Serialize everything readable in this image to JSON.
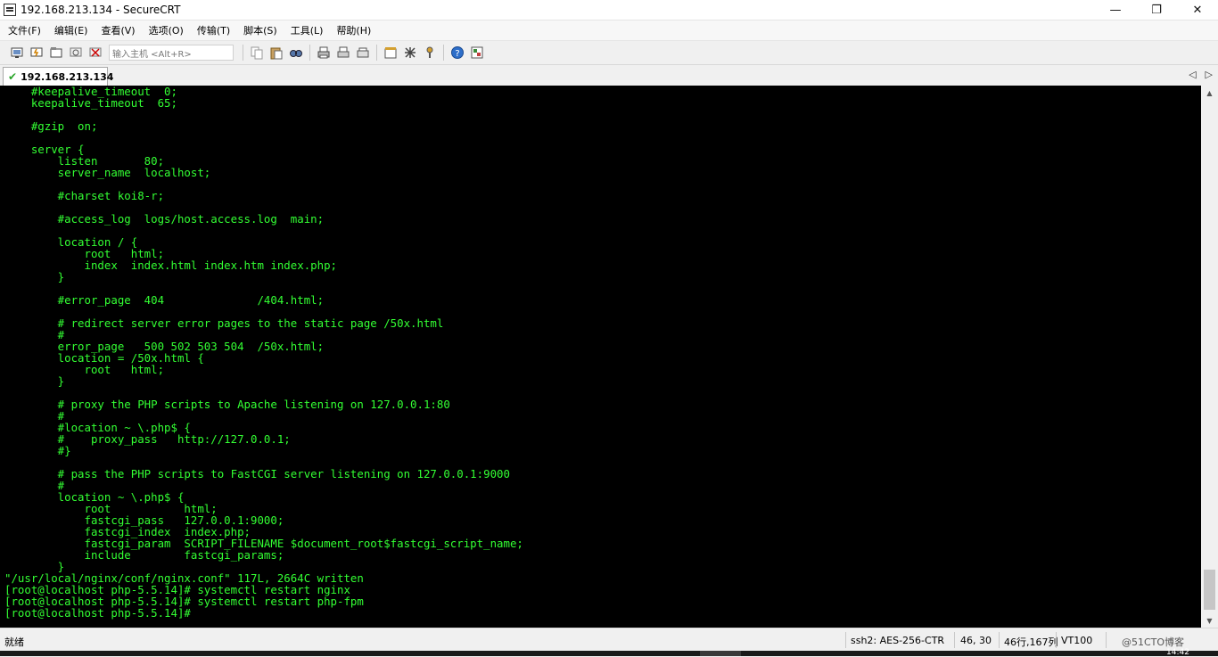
{
  "window": {
    "title": "192.168.213.134 - SecureCRT",
    "minimize": "—",
    "maximize": "❐",
    "close": "✕"
  },
  "menu": [
    "文件(F)",
    "编辑(E)",
    "查看(V)",
    "选项(O)",
    "传输(T)",
    "脚本(S)",
    "工具(L)",
    "帮助(H)"
  ],
  "toolbar": {
    "quick_connect_placeholder": "输入主机 <Alt+R>",
    "icons_left": [
      "connect-icon",
      "quick-connect-icon",
      "connect-tab-icon",
      "reconnect-icon",
      "disconnect-icon"
    ],
    "icons_right": [
      "copy-icon",
      "paste-icon",
      "find-icon",
      "print-icon",
      "print-selection-icon",
      "print-setup-icon",
      "session-options-icon",
      "global-options-icon",
      "keymap-icon",
      "help-icon",
      "sftp-icon"
    ]
  },
  "tab": {
    "label": "192.168.213.134",
    "status_icon": "connected-check-icon",
    "nav_left": "◁",
    "nav_right": "▷"
  },
  "terminal": {
    "text_color": "#33ff33",
    "background": "#000000",
    "lines": [
      "    #keepalive_timeout  0;",
      "    keepalive_timeout  65;",
      "",
      "    #gzip  on;",
      "",
      "    server {",
      "        listen       80;",
      "        server_name  localhost;",
      "",
      "        #charset koi8-r;",
      "",
      "        #access_log  logs/host.access.log  main;",
      "",
      "        location / {",
      "            root   html;",
      "            index  index.html index.htm index.php;",
      "        }",
      "",
      "        #error_page  404              /404.html;",
      "",
      "        # redirect server error pages to the static page /50x.html",
      "        #",
      "        error_page   500 502 503 504  /50x.html;",
      "        location = /50x.html {",
      "            root   html;",
      "        }",
      "",
      "        # proxy the PHP scripts to Apache listening on 127.0.0.1:80",
      "        #",
      "        #location ~ \\.php$ {",
      "        #    proxy_pass   http://127.0.0.1;",
      "        #}",
      "",
      "        # pass the PHP scripts to FastCGI server listening on 127.0.0.1:9000",
      "        #",
      "        location ~ \\.php$ {",
      "            root           html;",
      "            fastcgi_pass   127.0.0.1:9000;",
      "            fastcgi_index  index.php;",
      "            fastcgi_param  SCRIPT_FILENAME $document_root$fastcgi_script_name;",
      "            include        fastcgi_params;",
      "        }",
      "\"/usr/local/nginx/conf/nginx.conf\" 117L, 2664C written",
      "[root@localhost php-5.5.14]# systemctl restart nginx",
      "[root@localhost php-5.5.14]# systemctl restart php-fpm",
      "[root@localhost php-5.5.14]# "
    ]
  },
  "statusbar": {
    "ready": "就绪",
    "encryption": "ssh2: AES-256-CTR",
    "cursor": "46,  30",
    "size": "46行,167列",
    "emulation": "VT100",
    "watermark": "@51CTO博客"
  },
  "taskbar": {
    "clock": "14:42"
  }
}
